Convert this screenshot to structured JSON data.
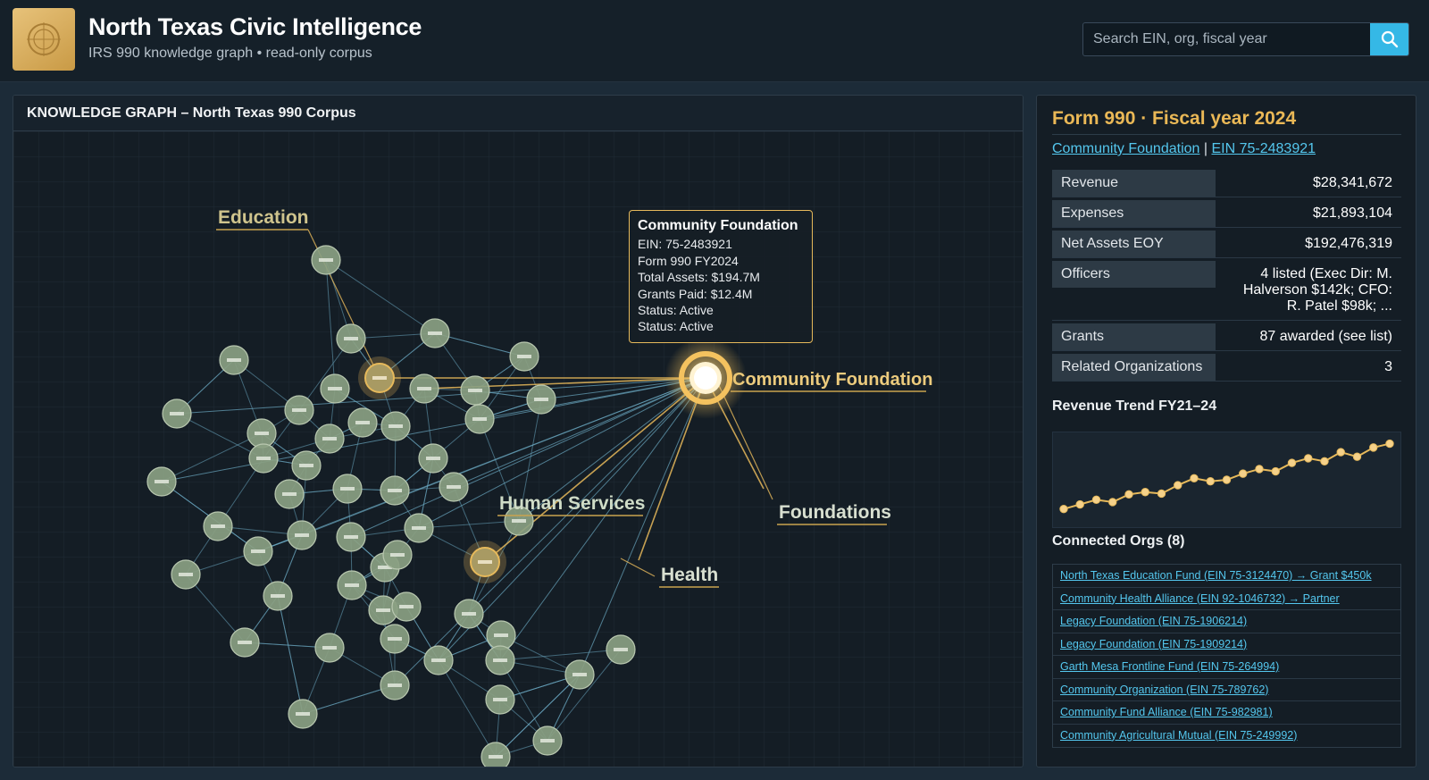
{
  "header": {
    "title": "North Texas Civic Intelligence",
    "subtitle": "IRS 990 knowledge graph • read-only corpus",
    "search_placeholder": "Search EIN, org, fiscal year",
    "logo_icon": "compass-icon",
    "search_icon": "search-icon"
  },
  "graph": {
    "title": "KNOWLEDGE GRAPH – North Texas 990 Corpus",
    "clusters": [
      {
        "label": "Education"
      },
      {
        "label": "Human Services"
      },
      {
        "label": "Foundations"
      },
      {
        "label": "Health"
      }
    ],
    "focus_label": "Community Foundation",
    "tooltip": {
      "title": "Community Foundation",
      "lines": [
        "EIN: 75-2483921",
        "Form 990 FY2024",
        "Total Assets: $194.7M",
        "Grants Paid: $12.4M",
        "Status: Active",
        "Status: Active"
      ]
    },
    "colors": {
      "node": "#8a9f82",
      "edge": "#6aa6bf",
      "highlight": "#e6b95b"
    }
  },
  "detail": {
    "title": "Form 990 · Fiscal year 2024",
    "org_name": "Community Foundation",
    "separator": "|",
    "ein": "EIN 75-2483921",
    "rows": [
      {
        "key": "Revenue",
        "value": "$28,341,672"
      },
      {
        "key": "Expenses",
        "value": "$21,893,104"
      },
      {
        "key": "Net Assets EOY",
        "value": "$192,476,319"
      },
      {
        "key": "Officers",
        "value": "4 listed (Exec Dir: M. Halverson $142k; CFO: R. Patel $98k; ..."
      },
      {
        "key": "Grants",
        "value": "87 awarded (see list)"
      },
      {
        "key": "Related Organizations",
        "value": "3"
      }
    ],
    "trend_title": "Revenue Trend FY21–24",
    "trend_values": [
      0.12,
      0.18,
      0.24,
      0.21,
      0.31,
      0.34,
      0.32,
      0.43,
      0.52,
      0.48,
      0.5,
      0.58,
      0.64,
      0.61,
      0.72,
      0.78,
      0.74,
      0.86,
      0.8,
      0.92,
      0.97
    ],
    "connected_title": "Connected Orgs (8)",
    "connected": [
      "North Texas Education Fund (EIN 75-3124470) → Grant $450k",
      "Community Health Alliance (EIN 92-1046732) → Partner",
      "Legacy Foundation (EIN 75-1906214)",
      "Legacy Foundation (EIN 75-1909214)",
      "Garth Mesa Frontline Fund (EIN 75-264994)",
      "Community Organization (EIN 75-789762)",
      "Community Fund Alliance (EIN 75-982981)",
      "Community Agricultural Mutual (EIN 75-249992)"
    ]
  }
}
